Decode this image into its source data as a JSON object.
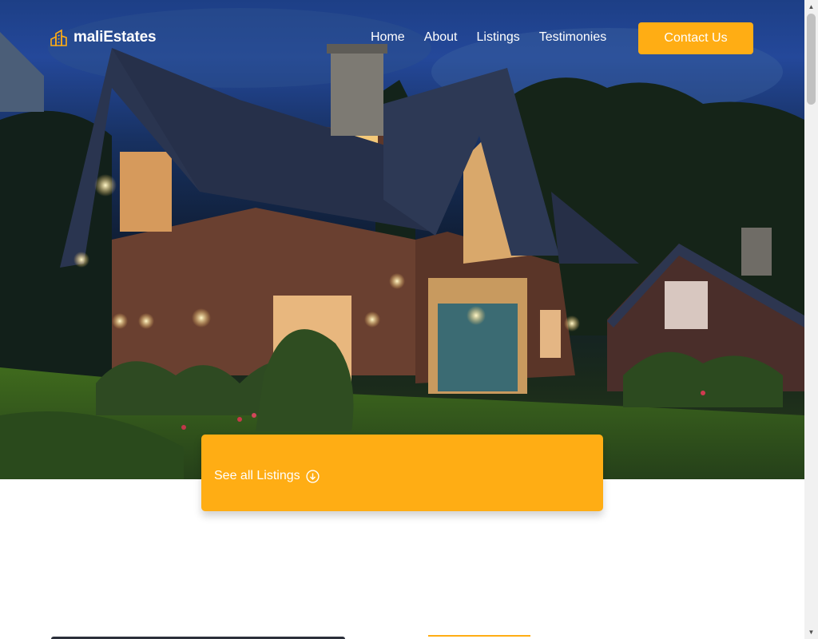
{
  "brand": {
    "name": "maliEstates",
    "icon": "building-icon",
    "accent": "#ffad14"
  },
  "nav": {
    "items": [
      {
        "label": "Home"
      },
      {
        "label": "About"
      },
      {
        "label": "Listings"
      },
      {
        "label": "Testimonies"
      }
    ],
    "cta_label": "Contact Us"
  },
  "hero": {
    "image": "house-at-dusk-photo",
    "cta_label": "See all Listings",
    "cta_icon": "arrow-down-circle-icon"
  }
}
